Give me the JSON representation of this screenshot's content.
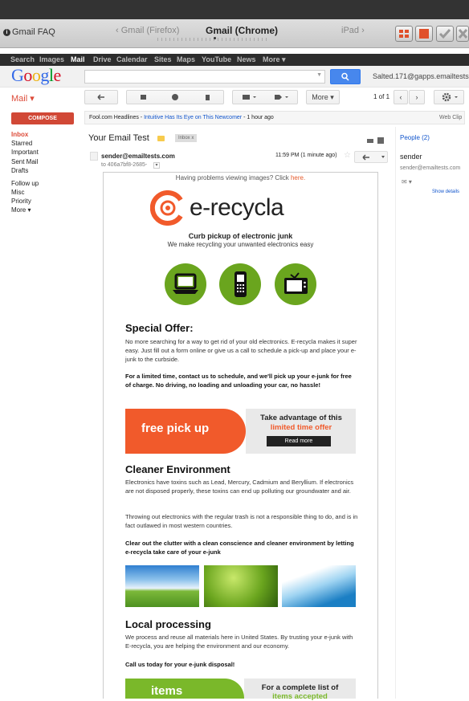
{
  "preview": {
    "faq": "Gmail FAQ",
    "tab_left": "‹ Gmail (Firefox)",
    "tab_active": "Gmail (Chrome)",
    "tab_right": "iPad ›"
  },
  "gbar": {
    "items": [
      "Search",
      "Images",
      "Mail",
      "Drive",
      "Calendar",
      "Sites",
      "Maps",
      "YouTube",
      "News",
      "More ▾"
    ]
  },
  "header": {
    "logo": "Google",
    "account": "Salted.171@gapps.emailtests.com"
  },
  "toolbar": {
    "more": "More ▾",
    "pagination": "1 of 1"
  },
  "sidebar": {
    "mail_label": "Mail ▾",
    "compose": "COMPOSE",
    "items": [
      "Inbox",
      "Starred",
      "Important",
      "Sent Mail",
      "Drafts",
      "Follow up",
      "Misc",
      "Priority",
      "More ▾"
    ]
  },
  "headline": {
    "source": "Fool.com Headlines - ",
    "title": "Intuitive Has Its Eye on This Newcomer",
    "age": " - 1 hour ago",
    "webclip": "Web Clip"
  },
  "message": {
    "subject": "Your Email Test",
    "label": "Inbox x",
    "sender": "sender@emailtests.com",
    "to": "to 406a7bf8-2685-",
    "time": "11:59 PM (1 minute ago)"
  },
  "right_panel": {
    "people": "People (2)",
    "sender_name": "sender",
    "sender_email": "sender@emailtests.com",
    "show_details": "Show details"
  },
  "email": {
    "problem_text": "Having problems viewing images? Click ",
    "problem_link": "here.",
    "brand": "e-recycla",
    "tagline1": "Curb pickup of electronic junk",
    "tagline2": "We make recycling your unwanted electronics easy",
    "offer_heading": "Special Offer:",
    "offer_p1": "No more searching for a way to get rid of your old electronics. E-recycla makes it super easy. Just fill out a form online or give us a call to schedule a pick-up and place your e-junk to the curbside.",
    "offer_p2": "For a limited time, contact us to schedule, and we'll pick up your e-junk for free of charge. No driving, no loading and unloading your car, no hassle!",
    "free_pickup": "free pick up",
    "take_advantage": "Take advantage of this",
    "limited_offer": "limited time offer",
    "read_more": "Read more",
    "env_heading": "Cleaner Environment",
    "env_p1": "Electronics have toxins such as Lead, Mercury, Cadmium and Beryllium. If electronics are not disposed properly, these toxins can end up polluting our groundwater and air.",
    "env_p2": "Throwing out electronics with the regular trash is not a responsible thing to do, and is in fact outlawed in most western countries.",
    "env_p3": "Clear out the clutter with a clean conscience and cleaner environment by letting e-recycla take care of your e-junk",
    "local_heading": "Local processing",
    "local_p1": "We process and reuse all materials here in United States. By trusting your e-junk with E-recycla, you are helping the environment and our economy.",
    "local_p2": "Call us today for your e-junk disposal!",
    "items_label": "items",
    "complete_list": "For a complete list of",
    "items_accepted": "items accepted"
  },
  "colors": {
    "brand_orange": "#f15a2b",
    "brand_green": "#6aa51e",
    "gmail_red": "#d14836",
    "link_blue": "#1155cc"
  }
}
